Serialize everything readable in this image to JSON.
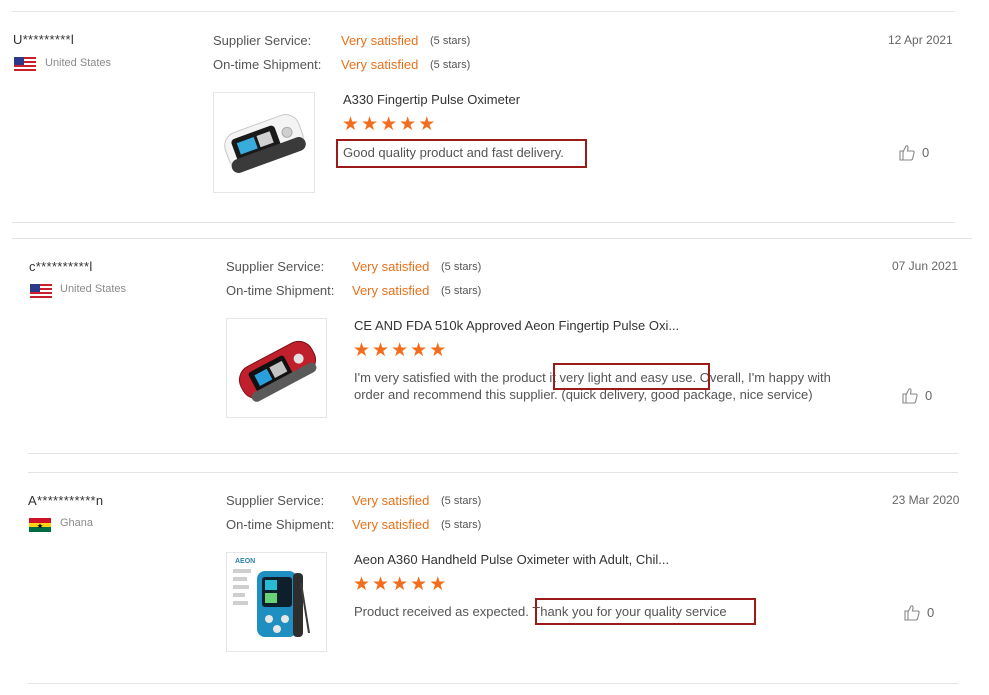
{
  "labels": {
    "supplier_service": "Supplier Service:",
    "on_time_shipment": "On-time Shipment:"
  },
  "reviews": [
    {
      "user": "U*********l",
      "country": "United States",
      "supplier_rating": "Very satisfied",
      "supplier_stars": "(5 stars)",
      "shipment_rating": "Very satisfied",
      "shipment_stars": "(5 stars)",
      "date": "12 Apr 2021",
      "product": "A330 Fingertip Pulse Oximeter",
      "stars": 5,
      "review_text": "Good quality product and fast delivery.",
      "likes": "0"
    },
    {
      "user": "c**********l",
      "country": "United States",
      "supplier_rating": "Very satisfied",
      "supplier_stars": "(5 stars)",
      "shipment_rating": "Very satisfied",
      "shipment_stars": "(5 stars)",
      "date": "07 Jun 2021",
      "product": "CE AND FDA 510k Approved Aeon Fingertip Pulse Oxi...",
      "stars": 5,
      "review_line1_a": "I'm very satisfied with the product",
      "review_line1_b": " it very light and easy use.",
      "review_line1_c": " Overall, I'm happy with",
      "review_line2": "order and recommend this supplier. (quick delivery, good package, nice service)",
      "likes": "0"
    },
    {
      "user": "A***********n",
      "country": "Ghana",
      "supplier_rating": "Very satisfied",
      "supplier_stars": "(5 stars)",
      "shipment_rating": "Very satisfied",
      "shipment_stars": "(5 stars)",
      "date": "23 Mar 2020",
      "product": "Aeon A360 Handheld Pulse Oximeter with Adult, Chil...",
      "stars": 5,
      "review_text_a": "Product received as expected.",
      "review_text_b": " Thank you for your quality service",
      "likes": "0",
      "brand_logo_text": "AEON"
    }
  ],
  "icons": {
    "star": "star-icon",
    "like": "thumbs-up-icon",
    "flag_us": "us-flag-icon",
    "flag_gh": "ghana-flag-icon"
  },
  "colors": {
    "satisfied": "#e8701a",
    "star": "#f26e1d",
    "highlight_box": "#9b1b1b"
  }
}
